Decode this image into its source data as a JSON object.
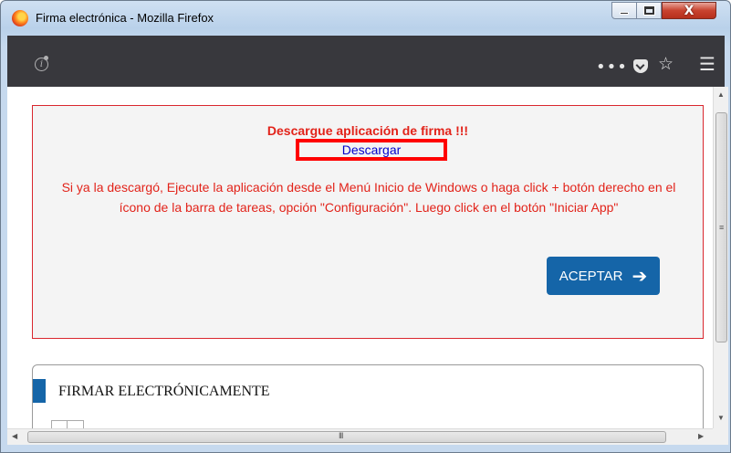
{
  "window": {
    "title": "Firma electrónica - Mozilla Firefox",
    "close_glyph": "X"
  },
  "toolbar": {
    "icons": [
      "info-icon",
      "more-icon",
      "pocket-icon",
      "star-icon",
      "menu-icon"
    ],
    "more_glyph": "•••",
    "star_glyph": "☆",
    "menu_glyph": "☰"
  },
  "modal": {
    "title": "Descargue aplicación de firma !!!",
    "download_link": "Descargar",
    "message": "Si ya la descargó, Ejecute la aplicación desde el Menú Inicio de Windows o haga click + botón derecho en el ícono de la barra de tareas, opción \"Configuración\". Luego click en el botón \"Iniciar App\"",
    "accept_button": "ACEPTAR",
    "accept_arrow": "➔"
  },
  "sign_panel": {
    "title": "FIRMAR ELECTRÓNICAMENTE"
  },
  "colors": {
    "alert_red": "#e2231a",
    "highlight_red": "#ff0000",
    "link_blue": "#0000cc",
    "button_blue": "#1565a8",
    "toolbar_dark": "#38383d"
  }
}
